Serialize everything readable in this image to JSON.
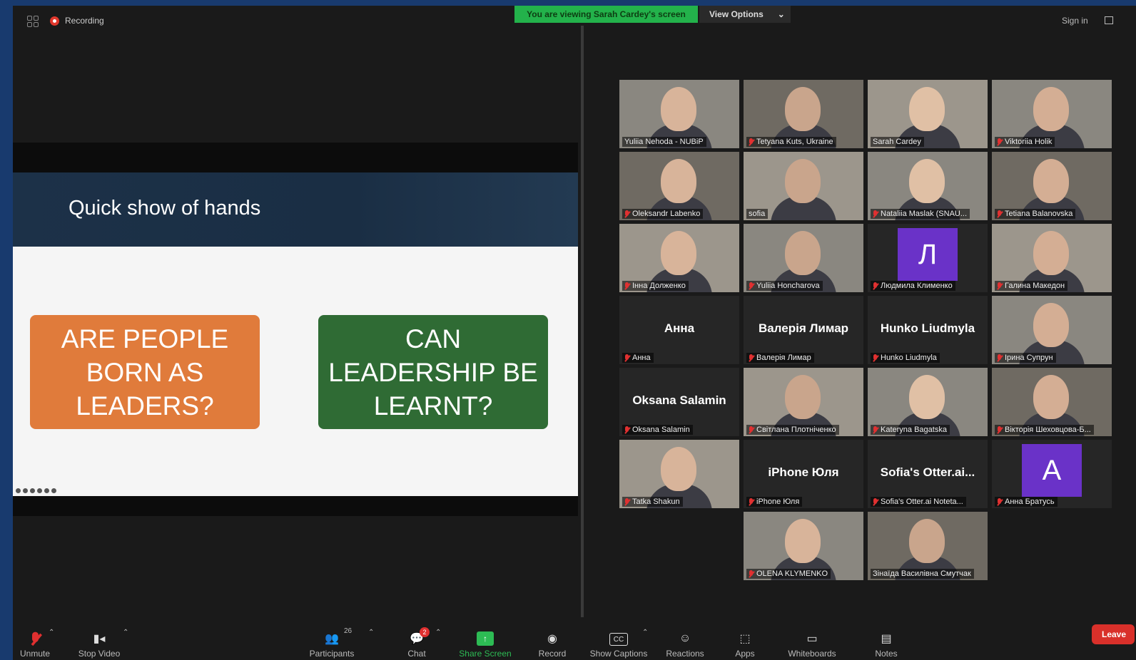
{
  "topbar": {
    "recording_label": "Recording",
    "viewing_banner": "You are viewing Sarah Cardey's screen",
    "view_options": "View Options",
    "sign_in": "Sign in"
  },
  "slide": {
    "title": "Quick show of hands",
    "box_left": "ARE PEOPLE BORN AS LEADERS?",
    "box_right": "CAN LEADERSHIP BE LEARNT?",
    "box_left_color": "#e07b3b",
    "box_right_color": "#2f6b34"
  },
  "gallery": {
    "tiles": [
      {
        "label": "Yuliia Nehoda - NUBiP",
        "muted": false
      },
      {
        "label": "Tetyana Kuts, Ukraine",
        "muted": true
      },
      {
        "label": "Sarah Cardey",
        "muted": false,
        "active": true
      },
      {
        "label": "Viktoriia Holik",
        "muted": true
      },
      {
        "label": "Oleksandr Labenko",
        "muted": true
      },
      {
        "label": "sofia",
        "muted": false
      },
      {
        "label": "Nataliia Maslak (SNAU...",
        "muted": true
      },
      {
        "label": "Tetiana Balanovska",
        "muted": true
      },
      {
        "label": "Інна Долженко",
        "muted": true
      },
      {
        "label": "Yuliia Honcharova",
        "muted": true
      },
      {
        "label": "Людмила Клименко",
        "muted": true,
        "avatar": "Л"
      },
      {
        "label": "Галина Македон",
        "muted": true
      },
      {
        "label": "Анна",
        "muted": true,
        "bigname": "Анна"
      },
      {
        "label": "Валерія Лимар",
        "muted": true,
        "bigname": "Валерія Лимар"
      },
      {
        "label": "Hunko Liudmyla",
        "muted": true,
        "bigname": "Hunko Liudmyla"
      },
      {
        "label": "Ірина Супрун",
        "muted": true
      },
      {
        "label": "Oksana Salamin",
        "muted": true,
        "bigname": "Oksana Salamin"
      },
      {
        "label": "Світлана Плотніченко",
        "muted": true
      },
      {
        "label": "Kateryna Bagatska",
        "muted": true
      },
      {
        "label": "Вікторія Шеховцова-Б...",
        "muted": true
      },
      {
        "label": "Tatka Shakun",
        "muted": true
      },
      {
        "label": "iPhone Юля",
        "muted": true,
        "bigname": "iPhone Юля"
      },
      {
        "label": "Sofia's Otter.ai Noteta...",
        "muted": true,
        "bigname": "Sofia's  Otter.ai..."
      },
      {
        "label": "Анна Братусь",
        "muted": true,
        "avatar": "A"
      },
      {
        "label": "OLENA KLYMENKO",
        "muted": true
      },
      {
        "label": "Зінаїда Василівна Смутчак",
        "muted": false
      }
    ]
  },
  "toolbar": {
    "unmute": "Unmute",
    "stop_video": "Stop Video",
    "participants": "Participants",
    "participants_count": "26",
    "chat": "Chat",
    "chat_badge": "2",
    "share_screen": "Share Screen",
    "record": "Record",
    "show_captions": "Show Captions",
    "reactions": "Reactions",
    "apps": "Apps",
    "whiteboards": "Whiteboards",
    "notes": "Notes",
    "leave": "Leave"
  }
}
